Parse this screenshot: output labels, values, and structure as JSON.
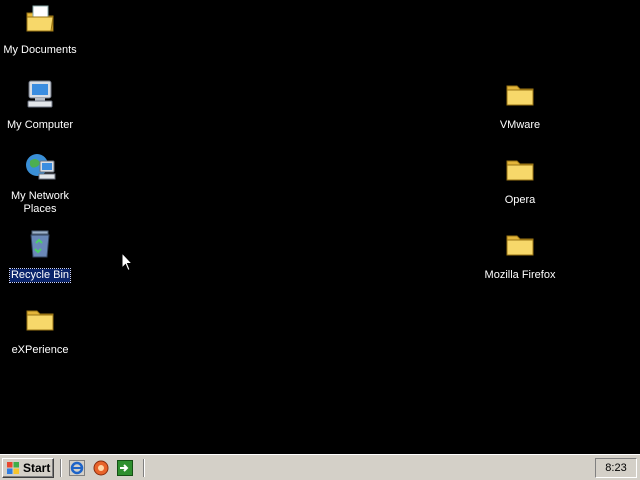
{
  "desktop": {
    "left_icons": [
      {
        "label": "My Documents",
        "icon": "my-documents-icon"
      },
      {
        "label": "My Computer",
        "icon": "my-computer-icon"
      },
      {
        "label": "My Network\nPlaces",
        "icon": "network-places-icon"
      },
      {
        "label": "Recycle Bin",
        "icon": "recycle-bin-icon",
        "selected": true
      },
      {
        "label": "eXPerience",
        "icon": "folder-icon"
      }
    ],
    "right_icons": [
      {
        "label": "VMware",
        "icon": "folder-icon"
      },
      {
        "label": "Opera",
        "icon": "folder-icon"
      },
      {
        "label": "Mozilla Firefox",
        "icon": "folder-icon"
      }
    ]
  },
  "taskbar": {
    "start_label": "Start",
    "quick_launch": [
      "internet-explorer-icon",
      "media-icon",
      "show-desktop-icon"
    ],
    "clock": "8:23"
  },
  "colors": {
    "desktop_bg": "#000000",
    "taskbar_bg": "#d4d0c8",
    "selection": "#0a246a",
    "folder": "#f3d35b"
  }
}
